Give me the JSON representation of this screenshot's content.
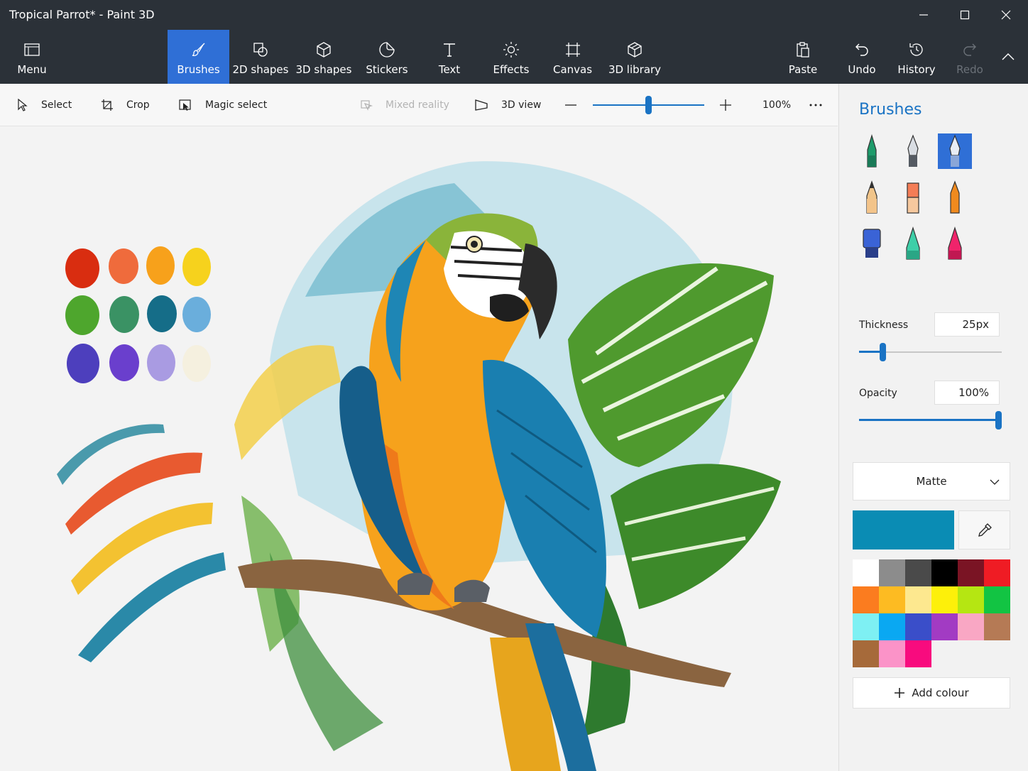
{
  "window": {
    "title": "Tropical Parrot* - Paint 3D"
  },
  "ribbon": {
    "menu": "Menu",
    "brushes": "Brushes",
    "shapes_2d": "2D shapes",
    "shapes_3d": "3D shapes",
    "stickers": "Stickers",
    "text": "Text",
    "effects": "Effects",
    "canvas": "Canvas",
    "library_3d": "3D library",
    "paste": "Paste",
    "undo": "Undo",
    "history": "History",
    "redo": "Redo"
  },
  "toolbar": {
    "select": "Select",
    "crop": "Crop",
    "magic_select": "Magic select",
    "mixed_reality": "Mixed reality",
    "view_3d": "3D view",
    "zoom": "100%",
    "zoom_value": 0.5
  },
  "panel": {
    "title": "Brushes",
    "thickness_label": "Thickness",
    "thickness_value": "25px",
    "thickness_level": 0.15,
    "opacity_label": "Opacity",
    "opacity_value": "100%",
    "opacity_level": 1.0,
    "finish": "Matte",
    "current_colour": "#0a8cb4",
    "add_colour": "Add colour",
    "palette": [
      "#ffffff",
      "#8c8c8c",
      "#4a4a4a",
      "#000000",
      "#7a1424",
      "#ef1c24",
      "#fb7c1f",
      "#fdbb22",
      "#fde88f",
      "#fdf00a",
      "#b5e612",
      "#12c443",
      "#7ef0f3",
      "#0aa8f2",
      "#3a4ec9",
      "#a23bc3",
      "#f9a7c4",
      "#b57a55",
      "#a66a3a",
      "#fb93c8",
      "#f80b7e"
    ]
  },
  "icons": {
    "selected_brush": "calligraphy-pen-icon"
  }
}
